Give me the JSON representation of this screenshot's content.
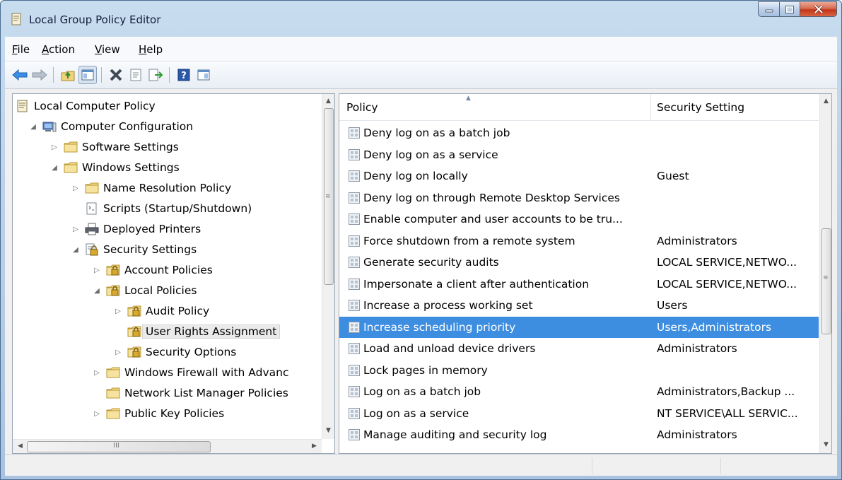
{
  "window": {
    "title": "Local Group Policy Editor",
    "icon": "policy-document-icon",
    "buttons": [
      "minimize-icon",
      "maximize-icon",
      "close-icon"
    ]
  },
  "menu": [
    {
      "accel": "F",
      "rest": "ile"
    },
    {
      "accel": "A",
      "rest": "ction"
    },
    {
      "accel": "V",
      "rest": "iew"
    },
    {
      "accel": "H",
      "rest": "elp"
    }
  ],
  "toolbar": {
    "icons": [
      "back-arrow-icon",
      "forward-arrow-icon",
      "up-folder-icon",
      "show-hide-console-tree-icon",
      "delete-icon",
      "properties-icon",
      "export-list-icon",
      "help-icon",
      "show-hide-action-pane-icon"
    ]
  },
  "tree": {
    "items": [
      {
        "label": "Local Computer Policy",
        "level": 0,
        "expander": "",
        "icon": "policy-document-icon"
      },
      {
        "label": "Computer Configuration",
        "level": 1,
        "expander": "expanded",
        "icon": "computer-icon"
      },
      {
        "label": "Software Settings",
        "level": 2,
        "expander": "collapsed",
        "icon": "folder-icon"
      },
      {
        "label": "Windows Settings",
        "level": 2,
        "expander": "expanded",
        "icon": "folder-icon"
      },
      {
        "label": "Name Resolution Policy",
        "level": 3,
        "expander": "collapsed",
        "icon": "folder-icon"
      },
      {
        "label": "Scripts (Startup/Shutdown)",
        "level": 3,
        "expander": "",
        "icon": "script-icon"
      },
      {
        "label": "Deployed Printers",
        "level": 3,
        "expander": "collapsed",
        "icon": "printer-icon"
      },
      {
        "label": "Security Settings",
        "level": 3,
        "expander": "expanded",
        "icon": "security-settings-icon"
      },
      {
        "label": "Account Policies",
        "level": 4,
        "expander": "collapsed",
        "icon": "security-folder-icon"
      },
      {
        "label": "Local Policies",
        "level": 4,
        "expander": "expanded",
        "icon": "security-folder-icon"
      },
      {
        "label": "Audit Policy",
        "level": 5,
        "expander": "collapsed",
        "icon": "security-folder-icon"
      },
      {
        "label": "User Rights Assignment",
        "level": 5,
        "expander": "",
        "icon": "security-folder-icon",
        "selected": true
      },
      {
        "label": "Security Options",
        "level": 5,
        "expander": "collapsed",
        "icon": "security-folder-icon"
      },
      {
        "label": "Windows Firewall with Advanc",
        "level": 4,
        "expander": "collapsed",
        "icon": "folder-icon"
      },
      {
        "label": "Network List Manager Policies",
        "level": 4,
        "expander": "",
        "icon": "folder-icon"
      },
      {
        "label": "Public Key Policies",
        "level": 4,
        "expander": "collapsed",
        "icon": "folder-icon"
      }
    ],
    "hscroll_grip": "III"
  },
  "list": {
    "columns": [
      "Policy",
      "Security Setting"
    ],
    "sorted_by": "Policy",
    "rows": [
      {
        "policy": "Deny log on as a batch job",
        "setting": ""
      },
      {
        "policy": "Deny log on as a service",
        "setting": ""
      },
      {
        "policy": "Deny log on locally",
        "setting": "Guest"
      },
      {
        "policy": "Deny log on through Remote Desktop Services",
        "setting": ""
      },
      {
        "policy": "Enable computer and user accounts to be tru...",
        "setting": ""
      },
      {
        "policy": "Force shutdown from a remote system",
        "setting": "Administrators"
      },
      {
        "policy": "Generate security audits",
        "setting": "LOCAL SERVICE,NETWO..."
      },
      {
        "policy": "Impersonate a client after authentication",
        "setting": "LOCAL SERVICE,NETWO..."
      },
      {
        "policy": "Increase a process working set",
        "setting": "Users"
      },
      {
        "policy": "Increase scheduling priority",
        "setting": "Users,Administrators",
        "selected": true
      },
      {
        "policy": "Load and unload device drivers",
        "setting": "Administrators"
      },
      {
        "policy": "Lock pages in memory",
        "setting": ""
      },
      {
        "policy": "Log on as a batch job",
        "setting": "Administrators,Backup ..."
      },
      {
        "policy": "Log on as a service",
        "setting": "NT SERVICE\\ALL SERVIC..."
      },
      {
        "policy": "Manage auditing and security log",
        "setting": "Administrators"
      }
    ],
    "row_icon": "policy-setting-icon"
  },
  "colors": {
    "selection": "#3d8ee0",
    "title_gradient": "#b7cde6",
    "close_button": "#c2351a"
  }
}
